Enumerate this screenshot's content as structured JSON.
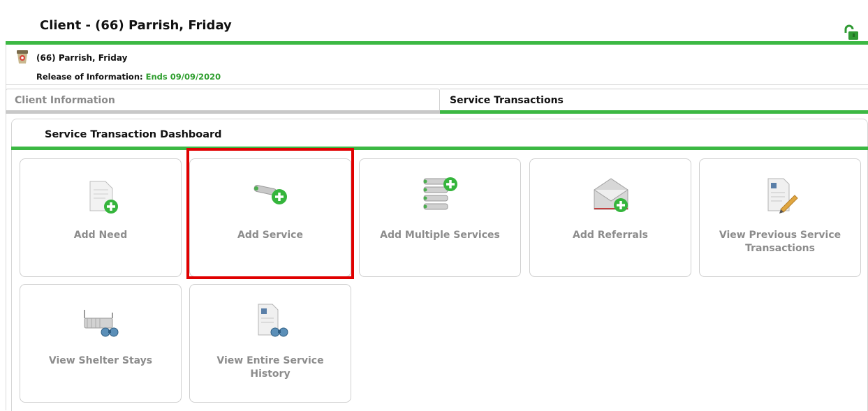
{
  "header": {
    "title": "Client - (66) Parrish, Friday",
    "lock_icon": "unlocked-padlock-icon",
    "accent_color": "#3cb843"
  },
  "client": {
    "name": "(66) Parrish, Friday",
    "roi_label": "Release of Information:",
    "roi_value": "Ends 09/09/2020",
    "avatar_icon": "client-avatar-icon"
  },
  "tabs": [
    {
      "label": "Client Information",
      "active": false
    },
    {
      "label": "Service Transactions",
      "active": true
    }
  ],
  "dashboard": {
    "title": "Service Transaction Dashboard",
    "tiles": [
      {
        "label": "Add Need",
        "icon": "add-need-document-icon"
      },
      {
        "label": "Add Service",
        "icon": "add-service-key-icon",
        "highlighted": true
      },
      {
        "label": "Add Multiple Services",
        "icon": "add-multiple-services-icon"
      },
      {
        "label": "Add Referrals",
        "icon": "add-referral-envelope-icon"
      },
      {
        "label": "View Previous Service Transactions",
        "icon": "view-previous-transactions-icon"
      },
      {
        "label": "View Shelter Stays",
        "icon": "view-shelter-stays-icon"
      },
      {
        "label": "View Entire Service History",
        "icon": "view-service-history-icon"
      }
    ]
  },
  "highlight_color": "#e00000"
}
